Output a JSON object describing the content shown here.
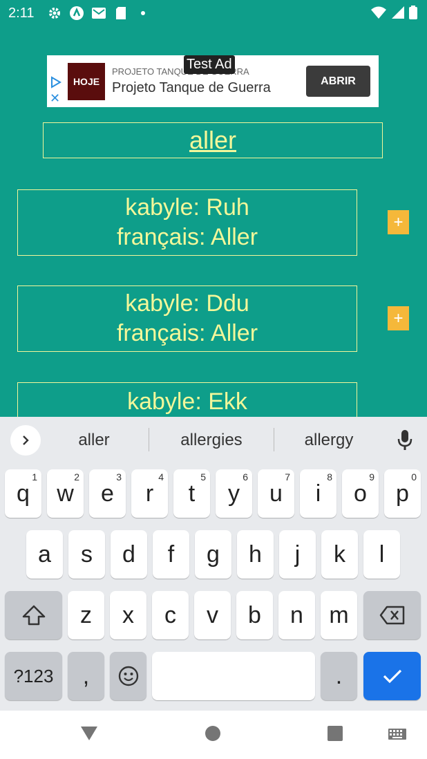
{
  "status": {
    "time": "2:11"
  },
  "ad": {
    "badge": "Test Ad",
    "advertiser_small": "PROJETO TANQUE DE GUERRA",
    "title": "Projeto Tanque de Guerra",
    "thumb_text": "HOJE",
    "button": "ABRIR"
  },
  "search": {
    "word": "aller"
  },
  "results": [
    {
      "kabyle": "kabyle: Ruh",
      "francais": "français: Aller",
      "add": "+"
    },
    {
      "kabyle": "kabyle: Ddu",
      "francais": "français: Aller",
      "add": "+"
    },
    {
      "kabyle": "kabyle: Ekk"
    }
  ],
  "keyboard": {
    "suggestions": [
      "aller",
      "allergies",
      "allergy"
    ],
    "row1": [
      {
        "k": "q",
        "h": "1"
      },
      {
        "k": "w",
        "h": "2"
      },
      {
        "k": "e",
        "h": "3"
      },
      {
        "k": "r",
        "h": "4"
      },
      {
        "k": "t",
        "h": "5"
      },
      {
        "k": "y",
        "h": "6"
      },
      {
        "k": "u",
        "h": "7"
      },
      {
        "k": "i",
        "h": "8"
      },
      {
        "k": "o",
        "h": "9"
      },
      {
        "k": "p",
        "h": "0"
      }
    ],
    "row2": [
      "a",
      "s",
      "d",
      "f",
      "g",
      "h",
      "j",
      "k",
      "l"
    ],
    "row3": [
      "z",
      "x",
      "c",
      "v",
      "b",
      "n",
      "m"
    ],
    "symbols_key": "?123",
    "comma_key": ",",
    "period_key": "."
  },
  "colors": {
    "background": "#0e9e8a",
    "accent_text": "#f3f79a",
    "add_button": "#f5b83a",
    "enter_key": "#1a73e8"
  }
}
